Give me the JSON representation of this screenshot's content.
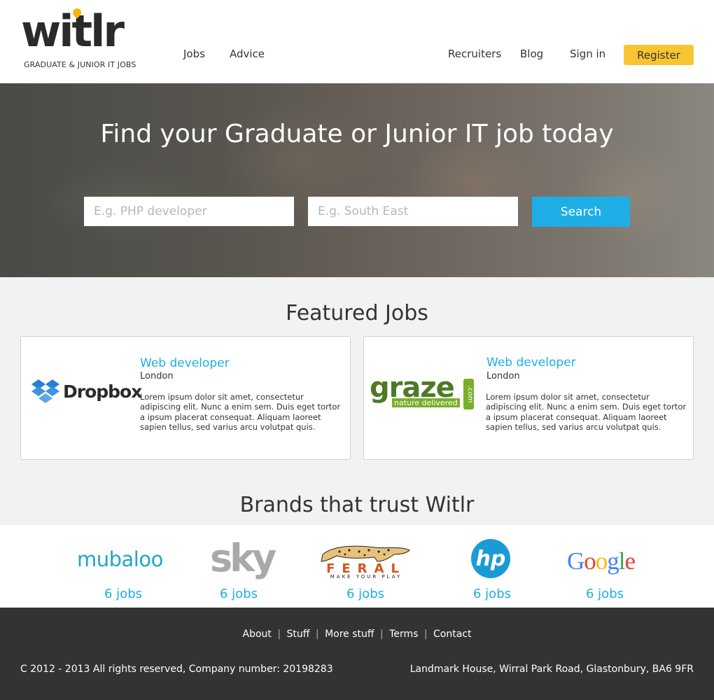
{
  "brand": {
    "logo_text": "witlr",
    "tagline": "GRADUATE & JUNIOR IT JOBS",
    "accent_color": "#f7c531",
    "link_color": "#1eaee6"
  },
  "nav": {
    "jobs": "Jobs",
    "advice": "Advice",
    "recruiters": "Recruiters",
    "blog": "Blog",
    "sign_in": "Sign in",
    "register": "Register"
  },
  "hero": {
    "title": "Find your Graduate or Junior IT job today",
    "keyword_placeholder": "E.g. PHP developer",
    "location_placeholder": "E.g. South East",
    "search_label": "Search"
  },
  "featured": {
    "title": "Featured Jobs",
    "jobs": [
      {
        "company_logo": "Dropbox",
        "title": "Web developer",
        "location": "London",
        "description": "Lorem ipsum dolor sit amet, consectetur adipiscing elit. Nunc a enim sem. Duis eget tortor a ipsum placerat consequat. Aliquam laoreet sapien tellus, sed varius arcu volutpat quis."
      },
      {
        "company_logo": "graze",
        "company_logo_tagline": "nature delivered",
        "company_logo_suffix": ".com",
        "title": "Web developer",
        "location": "London",
        "description": "Lorem ipsum dolor sit amet, consectetur adipiscing elit. Nunc a enim sem. Duis eget tortor a ipsum placerat consequat. Aliquam laoreet sapien tellus, sed varius arcu volutpat quis."
      }
    ]
  },
  "brands": {
    "title": "Brands that trust Witlr",
    "items": [
      {
        "logo": "mubaloo",
        "count": "6 jobs"
      },
      {
        "logo": "sky",
        "count": "6 jobs"
      },
      {
        "logo": "FERAL",
        "logo_tagline": "MAKE YOUR PLAY",
        "count": "6 jobs"
      },
      {
        "logo": "hp",
        "count": "6 jobs"
      },
      {
        "logo": "Google",
        "count": "6 jobs"
      }
    ]
  },
  "footer": {
    "links": [
      "About",
      "Stuff",
      "More stuff",
      "Terms",
      "Contact"
    ],
    "separator": "|",
    "copyright": "C   2012 - 2013 All rights reserved, Company number: 20198283",
    "address": "Landmark House, Wirral Park Road, Glastonbury, BA6 9FR"
  }
}
